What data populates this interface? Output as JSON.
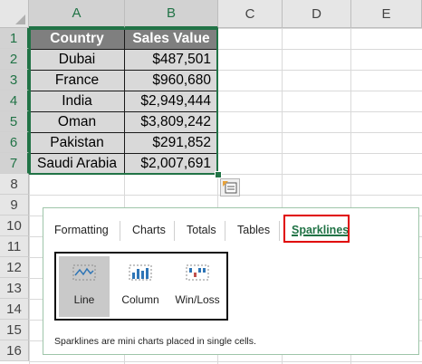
{
  "columns": [
    "A",
    "B",
    "C",
    "D",
    "E"
  ],
  "rows": [
    "1",
    "2",
    "3",
    "4",
    "5",
    "6",
    "7",
    "8",
    "9",
    "10",
    "11",
    "12",
    "13",
    "14",
    "15",
    "16"
  ],
  "table": {
    "headers": [
      "Country",
      "Sales Value"
    ],
    "data": [
      [
        "Dubai",
        "$487,501"
      ],
      [
        "France",
        "$960,680"
      ],
      [
        "India",
        "$2,949,444"
      ],
      [
        "Oman",
        "$3,809,242"
      ],
      [
        "Pakistan",
        "$291,852"
      ],
      [
        "Saudi Arabia",
        "$2,007,691"
      ]
    ]
  },
  "quick_analysis": {
    "tabs": [
      "Formatting",
      "Charts",
      "Totals",
      "Tables",
      "Sparklines"
    ],
    "active_tab": "Sparklines",
    "options": [
      {
        "label": "Line",
        "icon": "sparkline-line-icon",
        "selected": true
      },
      {
        "label": "Column",
        "icon": "sparkline-column-icon",
        "selected": false
      },
      {
        "label": "Win/Loss",
        "icon": "sparkline-winloss-icon",
        "selected": false
      }
    ],
    "description": "Sparklines are mini charts placed in single cells."
  },
  "colors": {
    "accent": "#217346",
    "header_fill": "#7f7f7f",
    "cell_fill": "#d9d9d9",
    "highlight": "#e00000",
    "sparkline": "#2e75b6"
  }
}
